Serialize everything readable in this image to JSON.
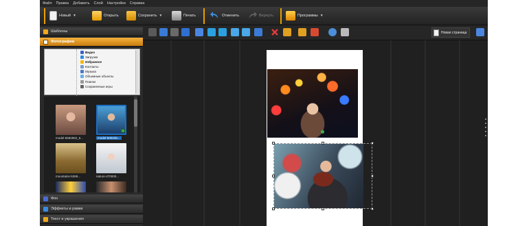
{
  "menu": [
    "Файл",
    "Правка",
    "Добавить",
    "Слой",
    "Настройки",
    "Справка"
  ],
  "toolbar": {
    "new_label": "Новый",
    "open_label": "Открыть",
    "save_label": "Сохранить",
    "print_label": "Печать",
    "undo_label": "Отменить",
    "redo_label": "Вернуть",
    "programs_label": "Программы"
  },
  "sidebar": {
    "templates_label": "Шаблоны",
    "photos_label": "Фотографии",
    "backgrounds_label": "Фон",
    "effects_label": "Эффекты и рамки",
    "text_label": "Текст и украшения"
  },
  "tree": [
    {
      "label": "Видео"
    },
    {
      "label": "Загрузки"
    },
    {
      "label": "Избранное"
    },
    {
      "label": "Контакты"
    },
    {
      "label": "Музыка"
    },
    {
      "label": "Объемные объекты"
    },
    {
      "label": "Поиски"
    },
    {
      "label": "Сохраненные игры"
    }
  ],
  "thumbnails": [
    {
      "caption": "model-5582962_6..."
    },
    {
      "caption": "model-600225..."
    },
    {
      "caption": "mountains-5369..."
    },
    {
      "caption": "nature-470000..."
    },
    {
      "caption": ""
    },
    {
      "caption": ""
    }
  ],
  "canvas_toolbar": {
    "new_page_label": "Новая страница"
  },
  "colors": {
    "accent": "#e8a000",
    "active_panel": "#e09a25",
    "selection": "#1e6fc0"
  }
}
